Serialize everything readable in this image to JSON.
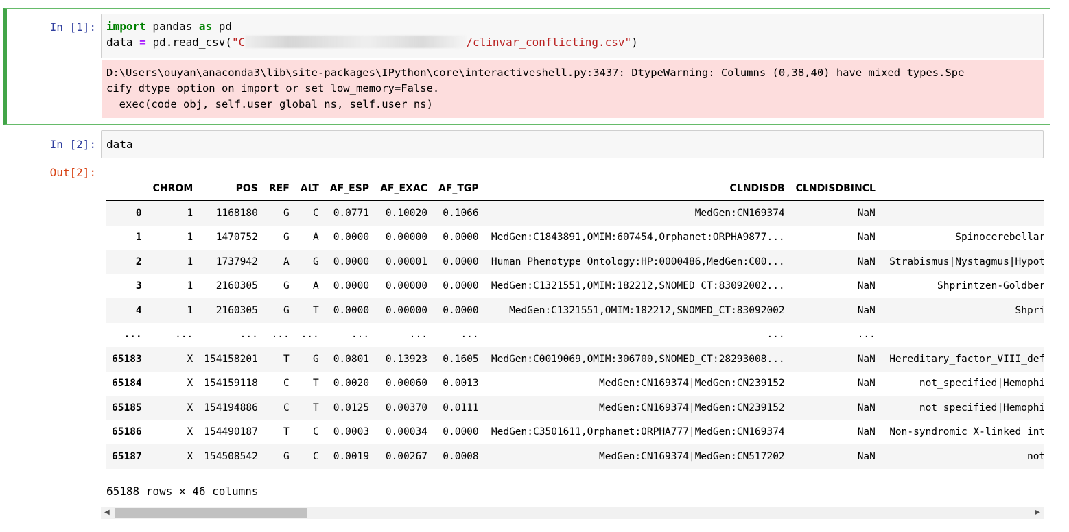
{
  "cells": [
    {
      "prompt": "In [1]:",
      "code": {
        "line1": {
          "kw1": "import",
          "t1": " pandas ",
          "kw2": "as",
          "t2": " pd"
        },
        "line2": {
          "t1": "data ",
          "op": "=",
          "t2": " pd.read_csv(",
          "str1": "\"C",
          "str2": "/clinvar_conflicting.csv\"",
          "t3": ")"
        }
      },
      "stderr": "D:\\Users\\ouyan\\anaconda3\\lib\\site-packages\\IPython\\core\\interactiveshell.py:3437: DtypeWarning: Columns (0,38,40) have mixed types.Spe\ncify dtype option on import or set low_memory=False.\n  exec(code_obj, self.user_global_ns, self.user_ns)"
    },
    {
      "prompt": "In [2]:",
      "code": "data",
      "out_prompt": "Out[2]:"
    }
  ],
  "dataframe": {
    "columns": [
      "",
      "CHROM",
      "POS",
      "REF",
      "ALT",
      "AF_ESP",
      "AF_EXAC",
      "AF_TGP",
      "CLNDISDB",
      "CLNDISDBINCL",
      ""
    ],
    "rows": [
      [
        "0",
        "1",
        "1168180",
        "G",
        "C",
        "0.0771",
        "0.10020",
        "0.1066",
        "MedGen:CN169374",
        "NaN",
        ""
      ],
      [
        "1",
        "1",
        "1470752",
        "G",
        "A",
        "0.0000",
        "0.00000",
        "0.0000",
        "MedGen:C1843891,OMIM:607454,Orphanet:ORPHA9877...",
        "NaN",
        "Spinocerebellar_"
      ],
      [
        "2",
        "1",
        "1737942",
        "A",
        "G",
        "0.0000",
        "0.00001",
        "0.0000",
        "Human_Phenotype_Ontology:HP:0000486,MedGen:C00...",
        "NaN",
        "Strabismus|Nystagmus|Hypoth"
      ],
      [
        "3",
        "1",
        "2160305",
        "G",
        "A",
        "0.0000",
        "0.00000",
        "0.0000",
        "MedGen:C1321551,OMIM:182212,SNOMED_CT:83092002...",
        "NaN",
        "Shprintzen-Goldberg"
      ],
      [
        "4",
        "1",
        "2160305",
        "G",
        "T",
        "0.0000",
        "0.00000",
        "0.0000",
        "MedGen:C1321551,OMIM:182212,SNOMED_CT:83092002",
        "NaN",
        "Shprir"
      ],
      [
        "...",
        "...",
        "...",
        "...",
        "...",
        "...",
        "...",
        "...",
        "...",
        "...",
        ""
      ],
      [
        "65183",
        "X",
        "154158201",
        "T",
        "G",
        "0.0801",
        "0.13923",
        "0.1605",
        "MedGen:C0019069,OMIM:306700,SNOMED_CT:28293008...",
        "NaN",
        "Hereditary_factor_VIII_defi"
      ],
      [
        "65184",
        "X",
        "154159118",
        "C",
        "T",
        "0.0020",
        "0.00060",
        "0.0013",
        "MedGen:CN169374|MedGen:CN239152",
        "NaN",
        "not_specified|Hemophil"
      ],
      [
        "65185",
        "X",
        "154194886",
        "C",
        "T",
        "0.0125",
        "0.00370",
        "0.0111",
        "MedGen:CN169374|MedGen:CN239152",
        "NaN",
        "not_specified|Hemophil"
      ],
      [
        "65186",
        "X",
        "154490187",
        "T",
        "C",
        "0.0003",
        "0.00034",
        "0.0000",
        "MedGen:C3501611,Orphanet:ORPHA777|MedGen:CN169374",
        "NaN",
        "Non-syndromic_X-linked_inte"
      ],
      [
        "65187",
        "X",
        "154508542",
        "G",
        "C",
        "0.0019",
        "0.00267",
        "0.0008",
        "MedGen:CN169374|MedGen:CN517202",
        "NaN",
        "not_"
      ]
    ],
    "shape_text": "65188 rows × 46 columns"
  },
  "scrollbar": {
    "left_arrow": "◀",
    "right_arrow": "▶"
  }
}
